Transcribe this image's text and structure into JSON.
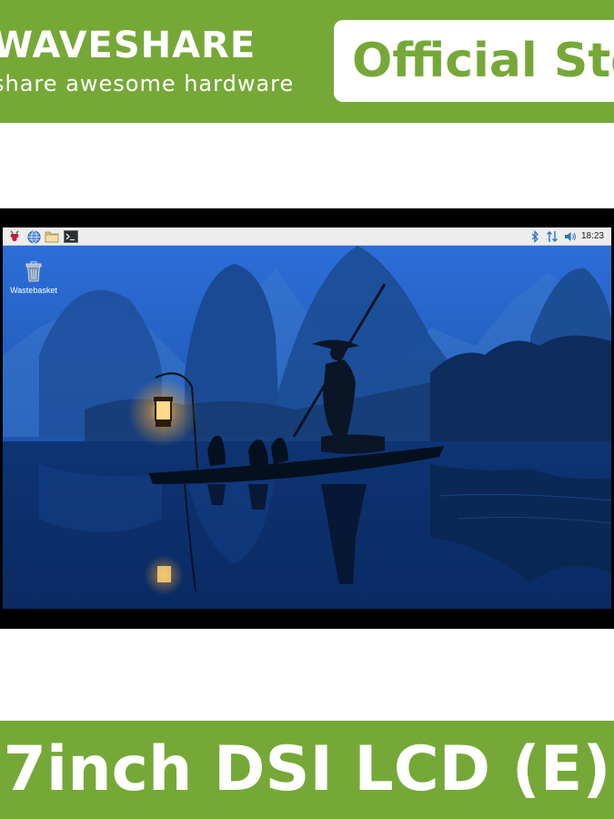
{
  "brand": {
    "name": "WAVESHARE",
    "tagline": "share awesome hardware",
    "store_label": "Official Sto"
  },
  "desktop": {
    "clock": "18:23",
    "wastebasket_label": "Wastebasket",
    "taskbar_icons": [
      "raspberry-menu-icon",
      "web-browser-icon",
      "file-manager-icon",
      "terminal-icon"
    ],
    "tray_icons": [
      "bluetooth-icon",
      "network-icon",
      "volume-icon"
    ]
  },
  "product": {
    "title": "7inch DSI LCD (E)"
  },
  "colors": {
    "brand_green": "#76a837",
    "white": "#ffffff",
    "taskbar": "#ededed",
    "bezel": "#000000"
  }
}
